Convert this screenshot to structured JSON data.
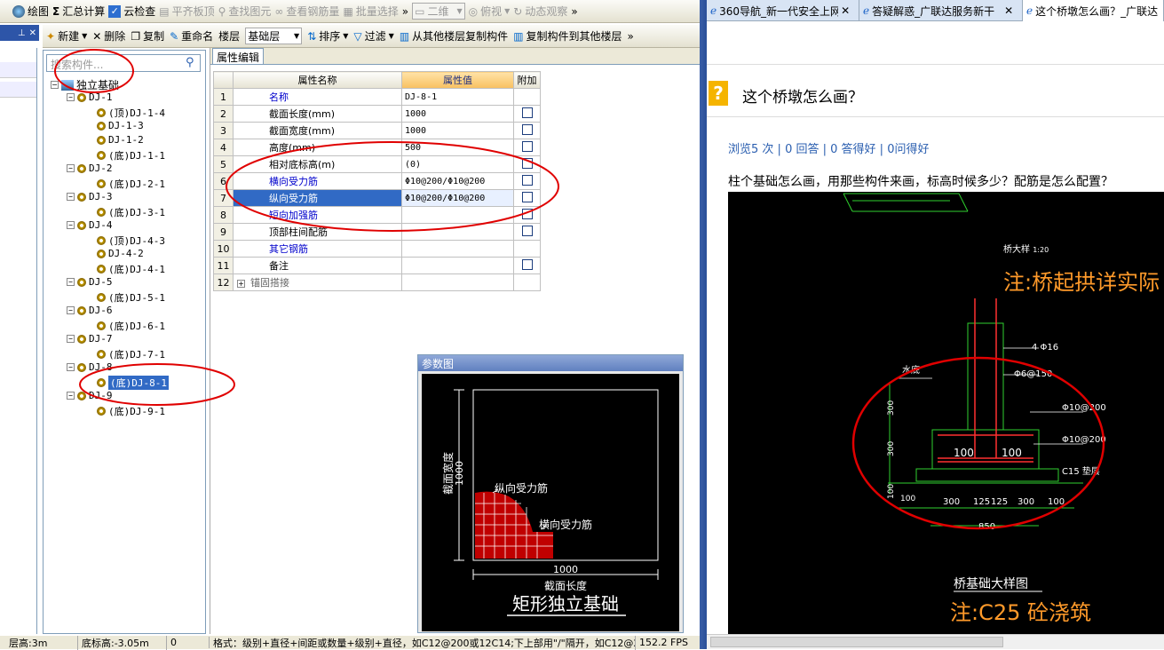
{
  "toolbar1": {
    "draw": "绘图",
    "sum": "汇总计算",
    "cloud_check": "云检查",
    "align_top": "平齐板顶",
    "find_element": "查找图元",
    "view_rebar": "查看钢筋量",
    "batch_select": "批量选择",
    "view_mode": "二维",
    "top_view": "俯视",
    "dynamic_view": "动态观察"
  },
  "toolbar2": {
    "new": "新建",
    "delete": "删除",
    "copy": "复制",
    "rename": "重命名",
    "floor_label": "楼层",
    "floor_value": "基础层",
    "sort": "排序",
    "filter": "过滤",
    "copy_from": "从其他楼层复制构件",
    "copy_to": "复制构件到其他楼层"
  },
  "tree": {
    "search_placeholder": "搜索构件...",
    "root": "独立基础",
    "nodes": [
      {
        "label": "DJ-1",
        "level": 1
      },
      {
        "label": "(顶)DJ-1-4",
        "level": 2
      },
      {
        "label": "DJ-1-3",
        "level": 2
      },
      {
        "label": "DJ-1-2",
        "level": 2
      },
      {
        "label": "(底)DJ-1-1",
        "level": 2
      },
      {
        "label": "DJ-2",
        "level": 1
      },
      {
        "label": "(底)DJ-2-1",
        "level": 2
      },
      {
        "label": "DJ-3",
        "level": 1
      },
      {
        "label": "(底)DJ-3-1",
        "level": 2
      },
      {
        "label": "DJ-4",
        "level": 1
      },
      {
        "label": "(顶)DJ-4-3",
        "level": 2
      },
      {
        "label": "DJ-4-2",
        "level": 2
      },
      {
        "label": "(底)DJ-4-1",
        "level": 2
      },
      {
        "label": "DJ-5",
        "level": 1
      },
      {
        "label": "(底)DJ-5-1",
        "level": 2
      },
      {
        "label": "DJ-6",
        "level": 1
      },
      {
        "label": "(底)DJ-6-1",
        "level": 2
      },
      {
        "label": "DJ-7",
        "level": 1
      },
      {
        "label": "(底)DJ-7-1",
        "level": 2
      },
      {
        "label": "DJ-8",
        "level": 1
      },
      {
        "label": "(底)DJ-8-1",
        "level": 2,
        "selected": true
      },
      {
        "label": "DJ-9",
        "level": 1
      },
      {
        "label": "(底)DJ-9-1",
        "level": 2
      }
    ]
  },
  "props": {
    "tab": "属性编辑",
    "col_name": "属性名称",
    "col_value": "属性值",
    "col_extra": "附加",
    "rows": [
      {
        "no": "1",
        "name": "名称",
        "value": "DJ-8-1",
        "blue": true,
        "check": false
      },
      {
        "no": "2",
        "name": "截面长度(mm)",
        "value": "1000",
        "blue": false,
        "check": true
      },
      {
        "no": "3",
        "name": "截面宽度(mm)",
        "value": "1000",
        "blue": false,
        "check": true
      },
      {
        "no": "4",
        "name": "高度(mm)",
        "value": "500",
        "blue": false,
        "check": true
      },
      {
        "no": "5",
        "name": "相对底标高(m)",
        "value": "(0)",
        "blue": false,
        "check": true
      },
      {
        "no": "6",
        "name": "横向受力筋",
        "value": "Φ10@200/Φ10@200",
        "blue": true,
        "check": true
      },
      {
        "no": "7",
        "name": "纵向受力筋",
        "value": "Φ10@200/Φ10@200",
        "blue": true,
        "check": true,
        "selected": true
      },
      {
        "no": "8",
        "name": "短向加强筋",
        "value": "",
        "blue": true,
        "check": true
      },
      {
        "no": "9",
        "name": "顶部柱间配筋",
        "value": "",
        "blue": false,
        "check": true
      },
      {
        "no": "10",
        "name": "其它钢筋",
        "value": "",
        "blue": true,
        "check": false
      },
      {
        "no": "11",
        "name": "备注",
        "value": "",
        "blue": false,
        "check": true
      },
      {
        "no": "12",
        "name": "锚固搭接",
        "value": "",
        "blue": false,
        "check": false,
        "expand": true
      }
    ]
  },
  "param_fig": {
    "title": "参数图",
    "width_label": "截面宽度",
    "width_value": "1000",
    "length_label": "截面长度",
    "length_value": "1000",
    "rebar_long": "纵向受力筋",
    "rebar_trans": "横向受力筋",
    "caption": "矩形独立基础"
  },
  "status": {
    "floor_height": "层高:3m",
    "bottom_elev": "底标高:-3.05m",
    "zero": "0",
    "hint": "格式：级别+直径+间距或数量+级别+直径，如C12@200或12C14;下上部用\"/\"隔开，如C12@200",
    "fps": "152.2 FPS"
  },
  "browser": {
    "tabs": [
      "360导航_新一代安全上网导",
      "答疑解惑_广联达服务新干",
      "这个桥墩怎么画？_广联达"
    ],
    "question_title": "这个桥墩怎么画？",
    "stats": [
      "浏览5 次",
      "0 回答",
      "0 答得好",
      "0问得好"
    ],
    "question_text": "柱个基础怎么画，用那些构件来画，标高时候多少？配筋是怎么配置？"
  },
  "cad": {
    "detail_label": "桥大样",
    "detail_scale": "1:20",
    "note1": "注:桥起拱详实际",
    "rebar_a": "4 Φ16",
    "rebar_b": "Φ6@150",
    "rebar_c": "Φ10@200",
    "rebar_d": "Φ10@200",
    "water_level": "水底",
    "h1": "300",
    "h2": "300",
    "h3": "100",
    "v1": "100",
    "v2": "100",
    "cushion": "C15 垫层",
    "dims": [
      "300",
      "125",
      "125",
      "300",
      "100"
    ],
    "left_100": "100",
    "total": "850",
    "drawing_title": "桥基础大样图",
    "note2": "注:C25 砼浇筑"
  },
  "colors": {
    "selection": "#316ac5",
    "annotation": "#e00000",
    "cad_orange": "#ff9a2a"
  }
}
